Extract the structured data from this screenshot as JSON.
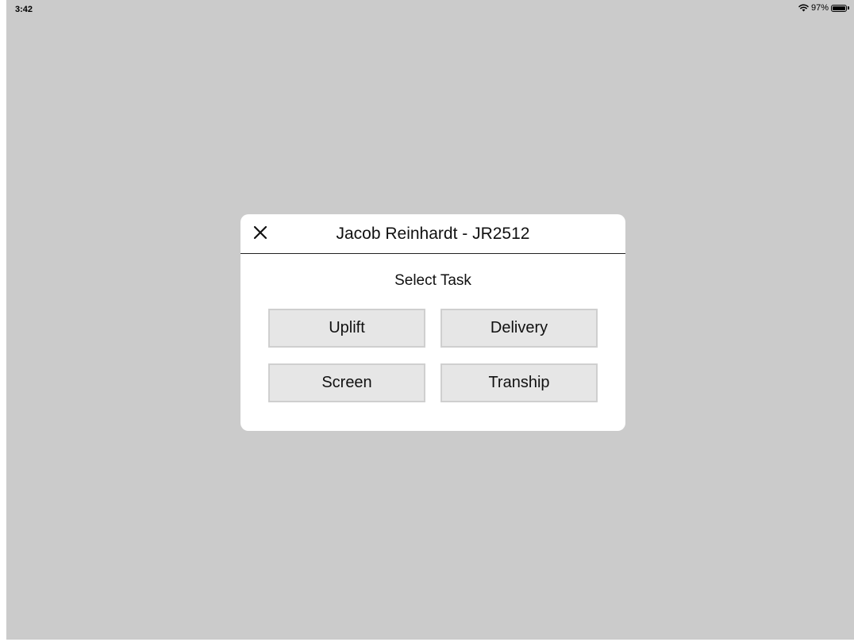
{
  "status_bar": {
    "time": "3:42",
    "battery_percent_text": "97%",
    "battery_level": 0.97,
    "wifi_icon": "wifi-icon",
    "battery_icon": "battery-icon"
  },
  "dialog": {
    "title": "Jacob Reinhardt - JR2512",
    "close_icon": "close-icon",
    "subtitle": "Select Task",
    "buttons": [
      {
        "label": "Uplift"
      },
      {
        "label": "Delivery"
      },
      {
        "label": "Screen"
      },
      {
        "label": "Tranship"
      }
    ]
  },
  "colors": {
    "backdrop": "#cbcbcb",
    "dialog_background": "#ffffff",
    "button_background": "#e6e6e6",
    "button_border": "#cfcfcf"
  }
}
